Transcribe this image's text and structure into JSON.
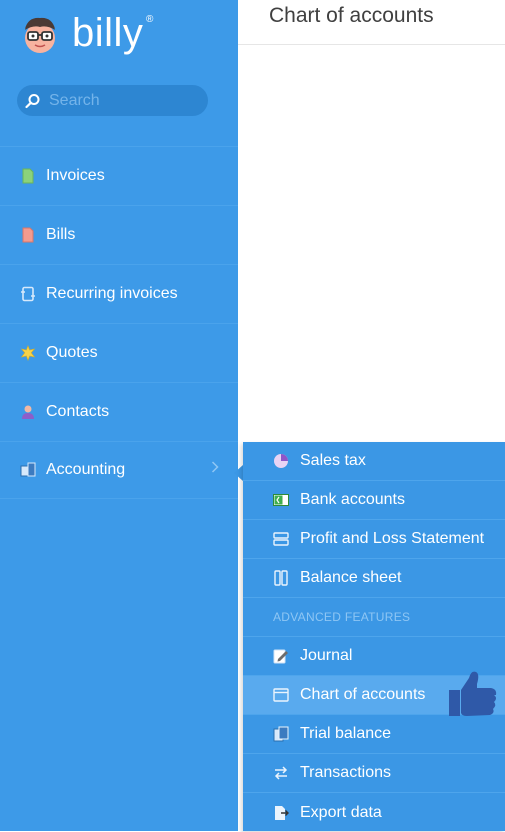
{
  "brand": {
    "name": "billy",
    "registered": "®"
  },
  "search": {
    "placeholder": "Search"
  },
  "nav": [
    {
      "label": "Invoices",
      "icon": "invoice-icon"
    },
    {
      "label": "Bills",
      "icon": "bill-icon"
    },
    {
      "label": "Recurring invoices",
      "icon": "recurring-icon"
    },
    {
      "label": "Quotes",
      "icon": "quote-icon"
    },
    {
      "label": "Contacts",
      "icon": "contact-icon"
    },
    {
      "label": "Accounting",
      "icon": "accounting-icon"
    }
  ],
  "page": {
    "title": "Chart of accounts"
  },
  "submenu": {
    "items": [
      {
        "label": "Sales tax",
        "icon": "pie-chart-icon"
      },
      {
        "label": "Bank accounts",
        "icon": "bank-card-icon"
      },
      {
        "label": "Profit and Loss Statement",
        "icon": "rows-icon"
      },
      {
        "label": "Balance sheet",
        "icon": "columns-icon"
      }
    ],
    "section_label": "ADVANCED FEATURES",
    "advanced_items": [
      {
        "label": "Journal",
        "icon": "journal-edit-icon"
      },
      {
        "label": "Chart of accounts",
        "icon": "window-icon",
        "active": true
      },
      {
        "label": "Trial balance",
        "icon": "document-icon"
      },
      {
        "label": "Transactions",
        "icon": "swap-arrows-icon"
      },
      {
        "label": "Export data",
        "icon": "export-icon"
      }
    ]
  },
  "colors": {
    "sidebar": "#3d9ae8",
    "submenu": "#3b97e5",
    "active": "#59aaee",
    "thumb": "#2f59a8"
  }
}
